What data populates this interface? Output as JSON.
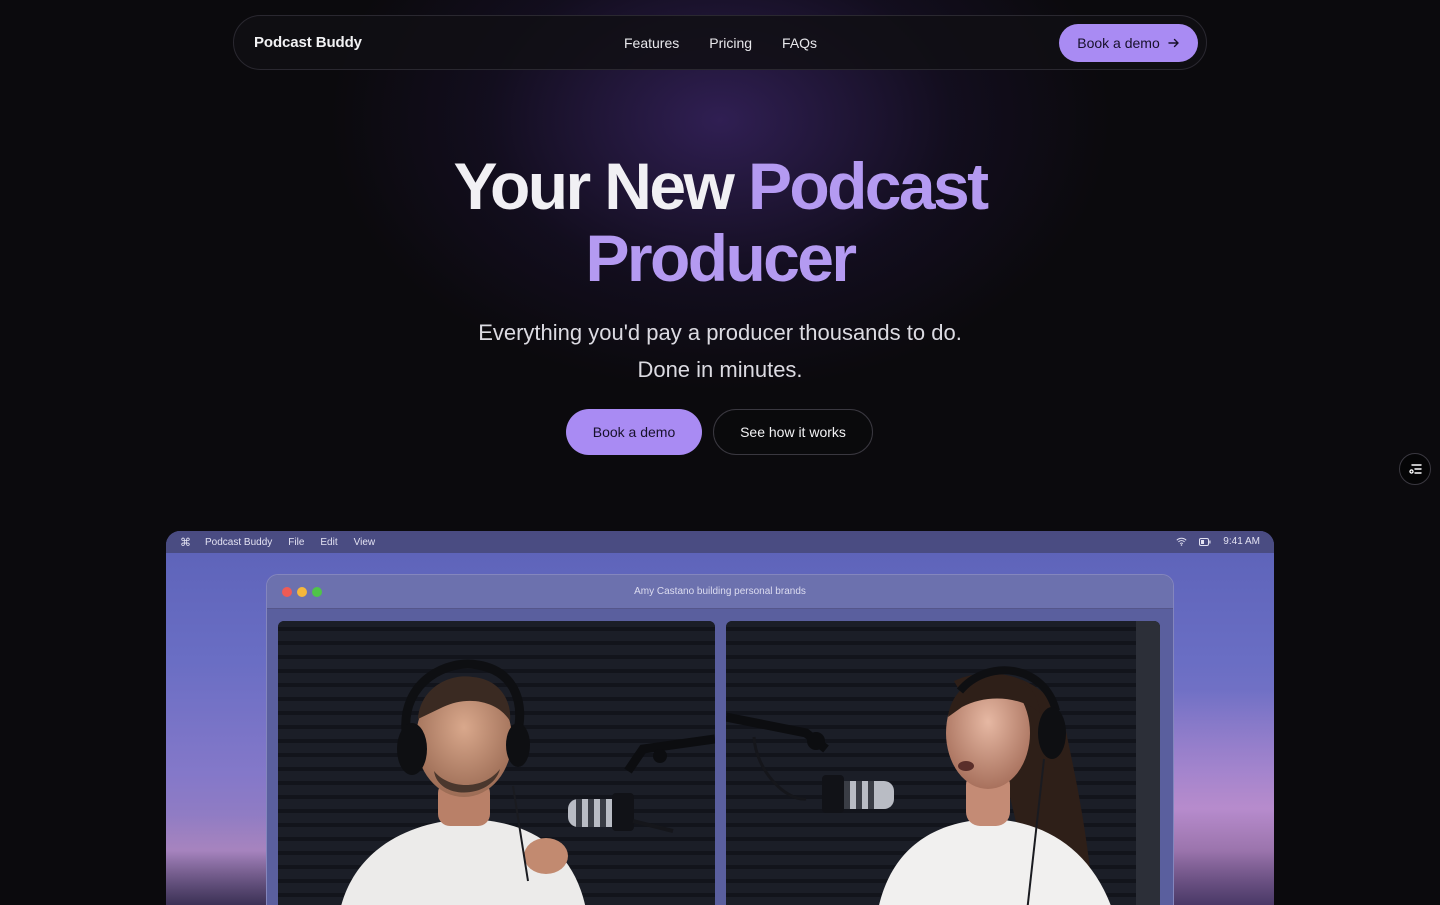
{
  "nav": {
    "brand": "Podcast Buddy",
    "links": [
      "Features",
      "Pricing",
      "FAQs"
    ],
    "cta_label": "Book a demo",
    "cta_icon": "arrow-right-icon"
  },
  "hero": {
    "title_white": "Your New",
    "title_accent_1": "Podcast",
    "title_accent_2": "Producer",
    "subtitle_line1": "Everything you'd pay a producer thousands to do.",
    "subtitle_line2": "Done in minutes.",
    "primary_button": "Book a demo",
    "secondary_button": "See how it works"
  },
  "floating_button": {
    "icon": "list-filter-icon"
  },
  "desktop": {
    "menubar": {
      "apple_icon": "command-icon",
      "items": [
        "Podcast Buddy",
        "File",
        "Edit",
        "View"
      ],
      "wifi_icon": "wifi-icon",
      "battery_icon": "battery-icon",
      "time": "9:41 AM"
    },
    "window": {
      "title": "Amy Castano building personal brands"
    }
  },
  "colors": {
    "accent": "#a98bf3",
    "title_accent": "#b49af1",
    "background": "#0b0a0d"
  }
}
